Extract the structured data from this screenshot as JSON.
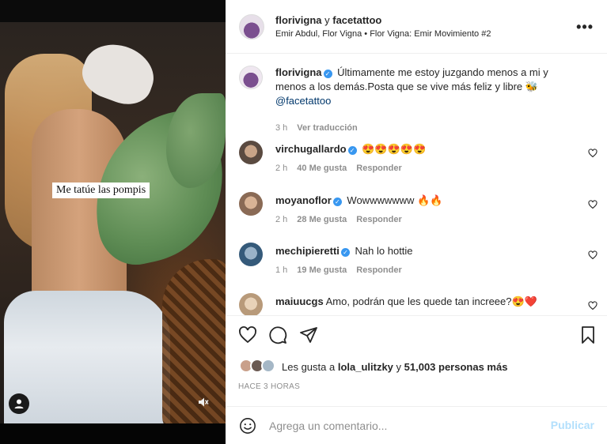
{
  "media": {
    "caption_overlay": "Me tatúe las pompis",
    "user_tag_icon": "person-icon",
    "mute_icon": "muted-speaker-icon"
  },
  "header": {
    "user1": "florivigna",
    "joiner": " y ",
    "user2": "facetattoo",
    "subtitle": "Emir Abdul, Flor Vigna • Flor Vigna: Emir Movimiento #2",
    "more_icon": "more-options-icon",
    "more_label": "•••"
  },
  "caption": {
    "user": "florivigna",
    "text": "Últimamente me estoy juzgando menos a mi y menos a los demás.Posta que se vive más feliz y libre 🐝",
    "mention": "@facetattoo",
    "time": "3 h",
    "translate": "Ver traducción"
  },
  "comments": [
    {
      "user": "virchugallardo",
      "text": "😍😍😍😍😍",
      "time": "2 h",
      "likes": "40 Me gusta",
      "reply": "Responder"
    },
    {
      "user": "moyanoflor",
      "text": "Wowwwwwww 🔥🔥",
      "time": "2 h",
      "likes": "28 Me gusta",
      "reply": "Responder"
    },
    {
      "user": "mechipieretti",
      "text": "Nah lo hottie",
      "time": "1 h",
      "likes": "19 Me gusta",
      "reply": "Responder"
    },
    {
      "user": "maiuucgs",
      "text": "Amo, podrán que les quede tan increee?😍❤️"
    }
  ],
  "likes": {
    "prefix": "Les gusta a ",
    "first": "lola_ulitzky",
    "middle": " y ",
    "count": "51,003 personas más"
  },
  "timeago": "HACE 3 HORAS",
  "add_comment": {
    "placeholder": "Agrega un comentario...",
    "publish": "Publicar"
  },
  "colors": {
    "verified": "#3897f0",
    "publish_disabled": "#b2dffc",
    "muted_text": "#8e8e8e"
  }
}
